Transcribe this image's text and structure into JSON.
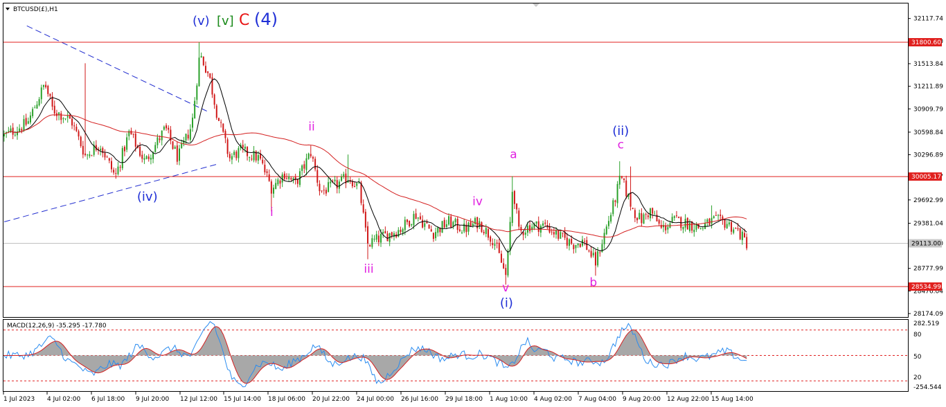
{
  "main_panel": {
    "symbol_label": "BTCUSD(£),H1",
    "header_labels": [
      {
        "text": "(v)",
        "color": "#1f2fd6"
      },
      {
        "text": "[v]",
        "color": "#1a8a1a"
      },
      {
        "text": "C",
        "color": "#e81414"
      },
      {
        "text": "(4)",
        "color": "#1f2fd6"
      }
    ],
    "price_scale": [
      "32117.74",
      "31815.80",
      "31513.84",
      "31211.89",
      "30909.79",
      "30598.84",
      "30296.89",
      "30005.17",
      "29692.99",
      "29381.04",
      "29113.00",
      "28777.99",
      "28476.04",
      "28174.09"
    ],
    "horizontal_lines": [
      {
        "price": 31800.6,
        "label": "31800.60",
        "color": "#e0201e"
      },
      {
        "price": 30005.17,
        "label": "30005.17",
        "color": "#e0201e"
      },
      {
        "price": 28534.99,
        "label": "28534.99",
        "color": "#e0201e"
      }
    ],
    "current_price": {
      "price": 29113.0,
      "label": "29113.00"
    },
    "wave_labels": [
      {
        "text": "(iv)",
        "color": "#1f2fd6",
        "time": 9.15,
        "price": 29680
      },
      {
        "text": "i",
        "color": "#e020e0",
        "time": 17.1,
        "price": 29480
      },
      {
        "text": "ii",
        "color": "#e020e0",
        "time": 19.65,
        "price": 30620
      },
      {
        "text": "iii",
        "color": "#e020e0",
        "time": 23.3,
        "price": 28720
      },
      {
        "text": "iv",
        "color": "#e020e0",
        "time": 30.25,
        "price": 29620
      },
      {
        "text": "a",
        "color": "#e020e0",
        "time": 32.55,
        "price": 30250
      },
      {
        "text": "v",
        "color": "#e020e0",
        "time": 32.05,
        "price": 28470
      },
      {
        "text": "(i)",
        "color": "#1f2fd6",
        "time": 32.1,
        "price": 28260
      },
      {
        "text": "b",
        "color": "#e020e0",
        "time": 37.65,
        "price": 28540
      },
      {
        "text": "(ii)",
        "color": "#1f2fd6",
        "time": 39.4,
        "price": 30560
      },
      {
        "text": "c",
        "color": "#e020e0",
        "time": 39.4,
        "price": 30380
      }
    ],
    "trendlines": [
      {
        "t1": 1.45,
        "p1": 32020,
        "t2": 12.95,
        "p2": 30880,
        "color": "#2430d0"
      },
      {
        "t1": 0.0,
        "p1": 29400,
        "t2": 13.6,
        "p2": 30170,
        "color": "#2430d0"
      }
    ]
  },
  "macd_panel": {
    "label": "MACD(12,26,9) -35.295 -17.780",
    "scale_labels": [
      "282.519",
      "80",
      "50",
      "20",
      "-254.544"
    ],
    "levels": [
      80,
      50,
      20
    ]
  },
  "time_axis": [
    "1 Jul 2023",
    "4 Jul 02:00",
    "6 Jul 18:00",
    "9 Jul 20:00",
    "12 Jul 12:00",
    "15 Jul 14:00",
    "18 Jul 06:00",
    "20 Jul 22:00",
    "24 Jul 00:00",
    "26 Jul 16:00",
    "29 Jul 18:00",
    "1 Aug 10:00",
    "4 Aug 02:00",
    "7 Aug 04:00",
    "9 Aug 20:00",
    "12 Aug 22:00",
    "15 Aug 14:00"
  ],
  "colors": {
    "bull_candle": "#2aa02a",
    "bear_candle": "#d01818",
    "ma_fast": "#000000",
    "ma_slow": "#d42020",
    "macd_hist": "#a8a8a8",
    "macd_main": "#2a8cf0",
    "macd_signal": "#d42020",
    "grid_line": "#c0c0c0"
  },
  "chart_data": {
    "type": "candlestick",
    "title": "BTCUSD(£),H1",
    "timeframe": "H1",
    "x_range": [
      "1 Jul 2023",
      "15 Aug 2023"
    ],
    "ylim": [
      28174.09,
      32117.74
    ],
    "anchors": [
      [
        0,
        30550
      ],
      [
        1.5,
        30720
      ],
      [
        2.6,
        31250
      ],
      [
        3.1,
        30900
      ],
      [
        4.3,
        30750
      ],
      [
        5.2,
        30280
      ],
      [
        6.1,
        30450
      ],
      [
        7.1,
        30000
      ],
      [
        8.0,
        30600
      ],
      [
        9.0,
        30200
      ],
      [
        10.3,
        30650
      ],
      [
        11.1,
        30250
      ],
      [
        12.0,
        30700
      ],
      [
        12.5,
        31650
      ],
      [
        13.1,
        31350
      ],
      [
        13.6,
        30850
      ],
      [
        14.4,
        30250
      ],
      [
        15.1,
        30350
      ],
      [
        16.3,
        30250
      ],
      [
        17.1,
        29850
      ],
      [
        17.9,
        30050
      ],
      [
        18.6,
        29900
      ],
      [
        19.6,
        30330
      ],
      [
        20.2,
        29800
      ],
      [
        21.3,
        29900
      ],
      [
        22.0,
        30000
      ],
      [
        22.7,
        29850
      ],
      [
        23.2,
        29100
      ],
      [
        24.2,
        29200
      ],
      [
        25.3,
        29300
      ],
      [
        26.3,
        29500
      ],
      [
        27.4,
        29250
      ],
      [
        28.4,
        29400
      ],
      [
        29.4,
        29300
      ],
      [
        30.3,
        29400
      ],
      [
        31.3,
        29150
      ],
      [
        32.1,
        28650
      ],
      [
        32.5,
        29900
      ],
      [
        32.9,
        29250
      ],
      [
        33.6,
        29350
      ],
      [
        34.6,
        29350
      ],
      [
        35.5,
        29200
      ],
      [
        36.4,
        29100
      ],
      [
        37.0,
        29150
      ],
      [
        37.8,
        28850
      ],
      [
        38.3,
        29200
      ],
      [
        38.9,
        29600
      ],
      [
        39.4,
        30000
      ],
      [
        40.2,
        29550
      ],
      [
        40.7,
        29420
      ],
      [
        41.3,
        29550
      ],
      [
        42.0,
        29300
      ],
      [
        42.8,
        29420
      ],
      [
        43.6,
        29380
      ],
      [
        44.5,
        29320
      ],
      [
        45.3,
        29420
      ],
      [
        46.2,
        29380
      ],
      [
        46.9,
        29270
      ],
      [
        47.45,
        29113
      ]
    ],
    "macd": {
      "main": -35.295,
      "signal": -17.78
    }
  }
}
